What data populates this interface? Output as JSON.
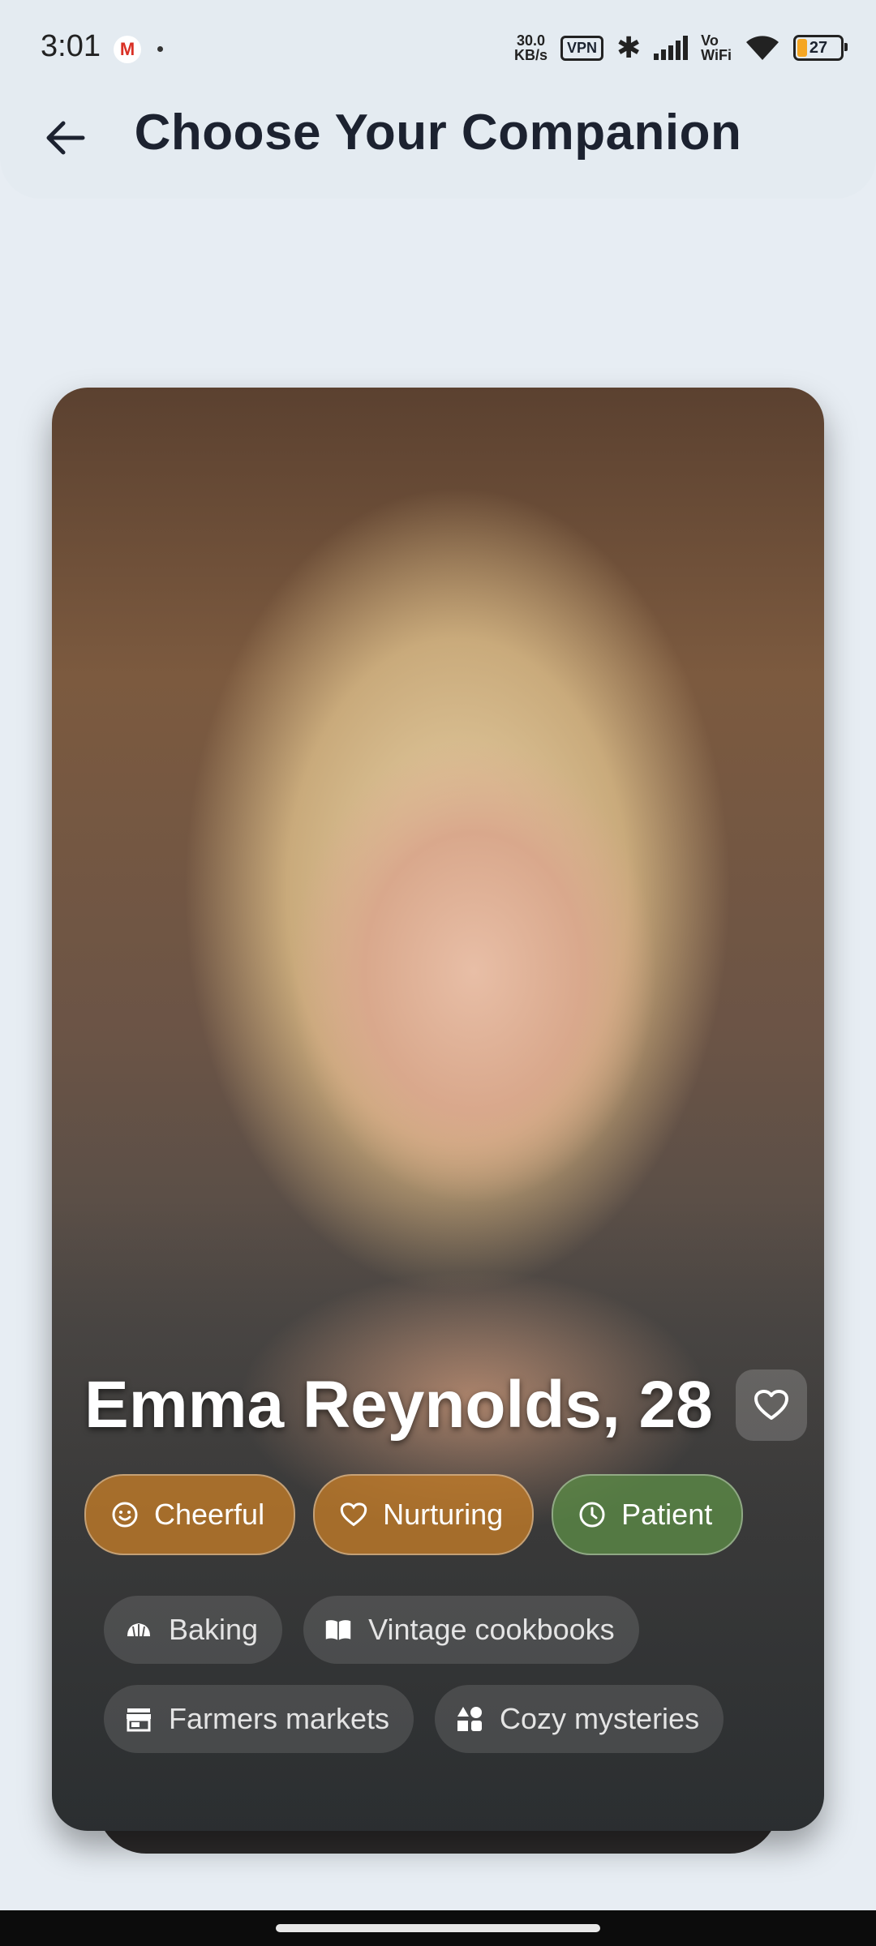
{
  "status_bar": {
    "time": "3:01",
    "gmail_icon": "gmail-icon",
    "net_speed_value": "30.0",
    "net_speed_unit": "KB/s",
    "vpn": "VPN",
    "vowifi_top": "Vo",
    "vowifi_bottom": "WiFi",
    "battery": "27"
  },
  "header": {
    "title": "Choose Your Companion",
    "back_icon": "arrow-left-icon"
  },
  "companion": {
    "name": "Emma Reynolds, 28",
    "favorite_icon": "heart-outline-icon",
    "traits": [
      {
        "label": "Cheerful",
        "icon": "smiley-icon",
        "color": "#c47c28"
      },
      {
        "label": "Nurturing",
        "icon": "heart-icon",
        "color": "#c47c28"
      },
      {
        "label": "Patient",
        "icon": "clock-icon",
        "color": "#5c8c46"
      }
    ],
    "interests": [
      {
        "label": "Baking",
        "icon": "bakery-icon"
      },
      {
        "label": "Vintage cookbooks",
        "icon": "book-icon"
      },
      {
        "label": "Farmers markets",
        "icon": "storefront-icon"
      },
      {
        "label": "Cozy mysteries",
        "icon": "category-icon"
      }
    ]
  }
}
